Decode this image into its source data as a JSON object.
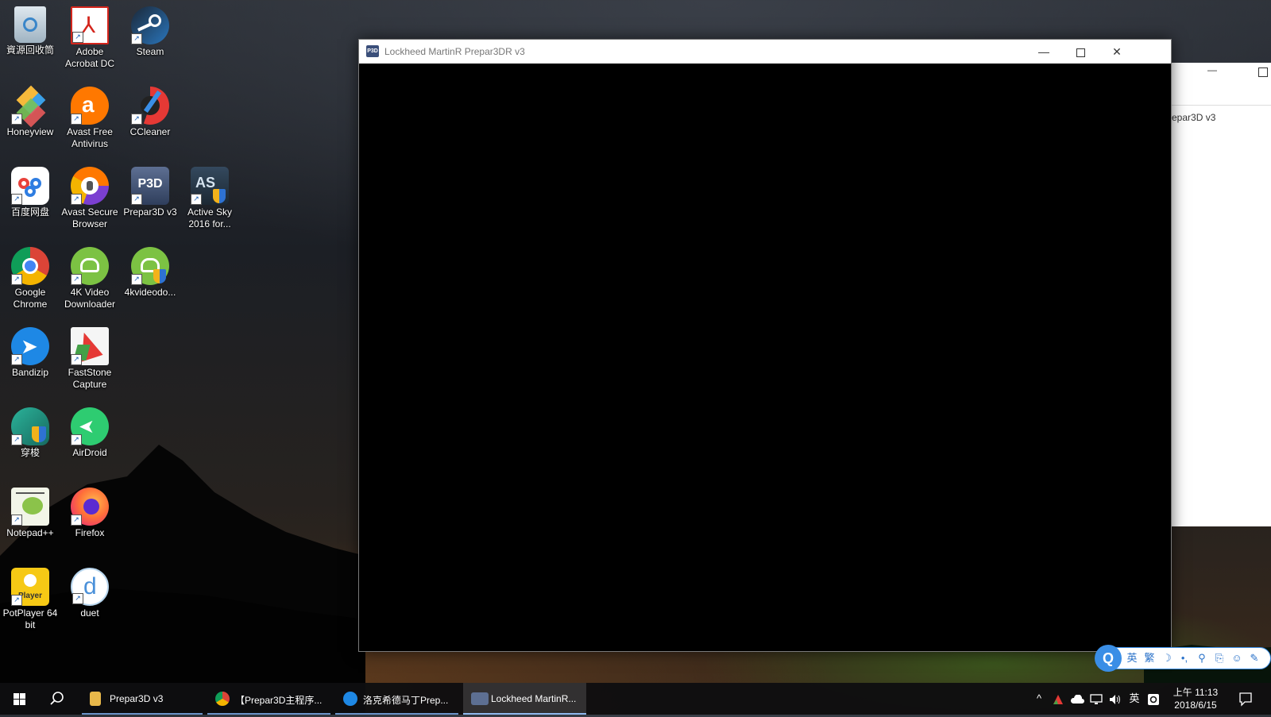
{
  "desktop": {
    "icons": [
      {
        "label": "資源回收筒",
        "icon": "recycle-bin-icon"
      },
      {
        "label": "Adobe Acrobat DC",
        "icon": "acrobat-icon"
      },
      {
        "label": "Steam",
        "icon": "steam-icon"
      },
      {
        "label": "Honeyview",
        "icon": "honeyview-icon"
      },
      {
        "label": "Avast Free Antivirus",
        "icon": "avast-icon"
      },
      {
        "label": "CCleaner",
        "icon": "ccleaner-icon"
      },
      {
        "label": "百度网盘",
        "icon": "baidu-netdisk-icon"
      },
      {
        "label": "Avast Secure Browser",
        "icon": "avast-browser-icon"
      },
      {
        "label": "Prepar3D v3",
        "icon": "p3d-icon"
      },
      {
        "label": "Active Sky 2016 for...",
        "icon": "active-sky-icon"
      },
      {
        "label": "Google Chrome",
        "icon": "chrome-icon"
      },
      {
        "label": "4K Video Downloader",
        "icon": "4k-video-icon"
      },
      {
        "label": "4kvideodo...",
        "icon": "4k-video-setup-icon"
      },
      {
        "label": "Bandizip",
        "icon": "bandizip-icon"
      },
      {
        "label": "FastStone Capture",
        "icon": "faststone-icon"
      },
      {
        "label": "穿梭",
        "icon": "chuansuo-icon"
      },
      {
        "label": "AirDroid",
        "icon": "airdroid-icon"
      },
      {
        "label": "Notepad++",
        "icon": "notepad-plus-plus-icon"
      },
      {
        "label": "Firefox",
        "icon": "firefox-icon"
      },
      {
        "label": "PotPlayer 64 bit",
        "icon": "potplayer-icon"
      },
      {
        "label": "duet",
        "icon": "duet-icon"
      }
    ]
  },
  "main_window": {
    "title": "Lockheed MartinR Prepar3DR v3",
    "app_icon_text": "P3D",
    "minimize_symbol": "—",
    "close_symbol": "✕"
  },
  "background_window": {
    "label": "Prepar3D v3",
    "minimize_symbol": "—"
  },
  "ime_bar": {
    "items": [
      "英",
      "繁",
      "☽",
      "•,",
      "⚲",
      "⎘",
      "☺",
      "✎"
    ]
  },
  "taskbar": {
    "apps": [
      {
        "label": "Prepar3D v3",
        "icon": "folder-icon",
        "color": "#e8b84a"
      },
      {
        "label": "【Prepar3D主程序...",
        "icon": "chrome-icon",
        "color": "#db4437"
      },
      {
        "label": "洛克希德马丁Prep...",
        "icon": "bandizip-icon",
        "color": "#1e88e5"
      },
      {
        "label": "Lockheed MartinR...",
        "icon": "p3d-icon",
        "color": "#3b4f7a"
      }
    ],
    "tray": {
      "chevron": "^",
      "ime_label": "英",
      "time": "上午 11:13",
      "date": "2018/6/15"
    }
  },
  "colors": {
    "taskbar_accent": "#6b93c9",
    "ime_blue": "#3a8ee6"
  }
}
